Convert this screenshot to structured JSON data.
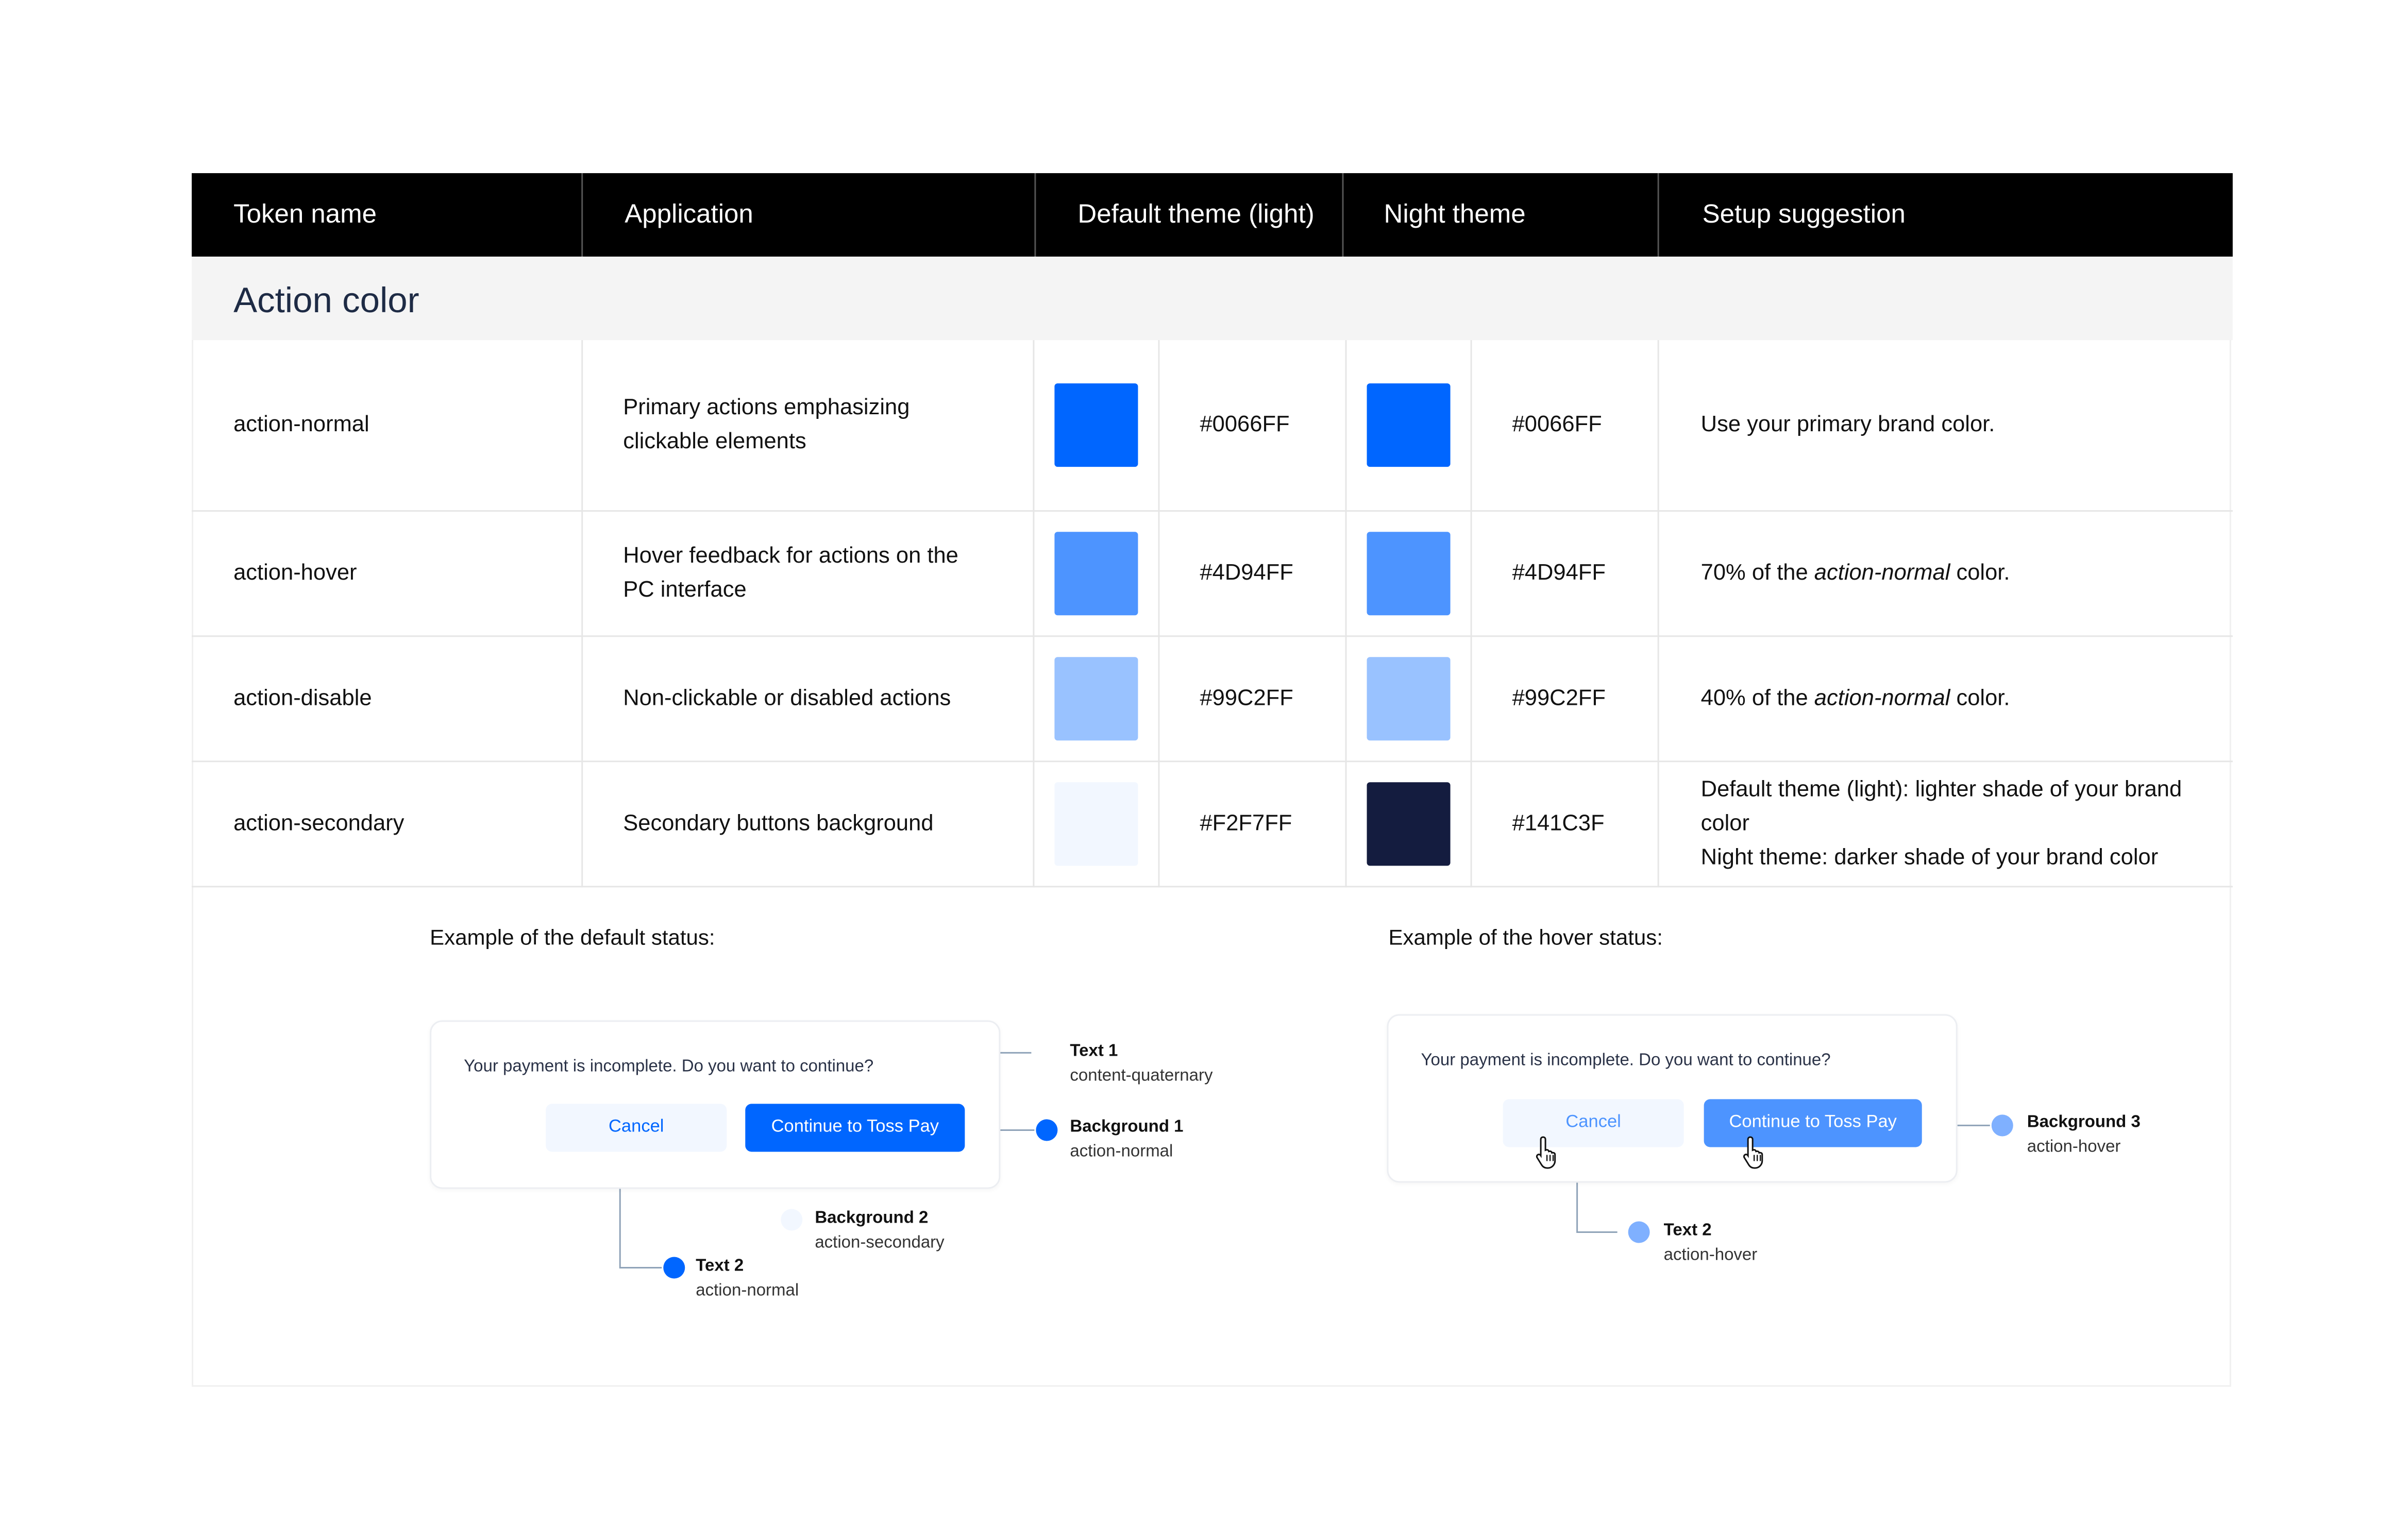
{
  "colors": {
    "header_bg": "#000000",
    "section_bg": "#F4F4F4",
    "accent": "#0066FF"
  },
  "header": {
    "col_token": "Token name",
    "col_application": "Application",
    "col_default": "Default theme (light)",
    "col_night": "Night theme",
    "col_setup": "Setup suggestion"
  },
  "section_title": "Action color",
  "rows": [
    {
      "token": "action-normal",
      "application": "Primary actions emphasizing clickable elements",
      "default_hex": "#0066FF",
      "night_hex": "#0066FF",
      "setup_plain": "Use your primary brand color."
    },
    {
      "token": "action-hover",
      "application": "Hover feedback for actions on the PC interface",
      "default_hex": "#4D94FF",
      "night_hex": "#4D94FF",
      "setup_pre": "70% of the ",
      "setup_em": "action-normal",
      "setup_post": " color."
    },
    {
      "token": "action-disable",
      "application": "Non-clickable or disabled actions",
      "default_hex": "#99C2FF",
      "night_hex": "#99C2FF",
      "setup_pre": "40% of the ",
      "setup_em": "action-normal",
      "setup_post": " color."
    },
    {
      "token": "action-secondary",
      "application": "Secondary buttons background",
      "default_hex": "#F2F7FF",
      "night_hex": "#141C3F",
      "setup_line1": "Default theme (light): lighter shade of your brand color",
      "setup_line2": "Night theme: darker shade of your brand color"
    }
  ],
  "example_default": {
    "label": "Example of the default status:",
    "message": "Your payment is incomplete. Do you want to continue?",
    "cancel": "Cancel",
    "continue": "Continue to Toss Pay",
    "annotations": {
      "text1_title": "Text 1",
      "text1_sub": "content-quaternary",
      "bg1_title": "Background 1",
      "bg1_sub": "action-normal",
      "bg2_title": "Background 2",
      "bg2_sub": "action-secondary",
      "text2_title": "Text 2",
      "text2_sub": "action-normal"
    }
  },
  "example_hover": {
    "label": "Example of the hover status:",
    "message": "Your payment is incomplete. Do you want to continue?",
    "cancel": "Cancel",
    "continue": "Continue to Toss Pay",
    "annotations": {
      "bg3_title": "Background 3",
      "bg3_sub": "action-hover",
      "text2_title": "Text 2",
      "text2_sub": "action-hover"
    }
  }
}
